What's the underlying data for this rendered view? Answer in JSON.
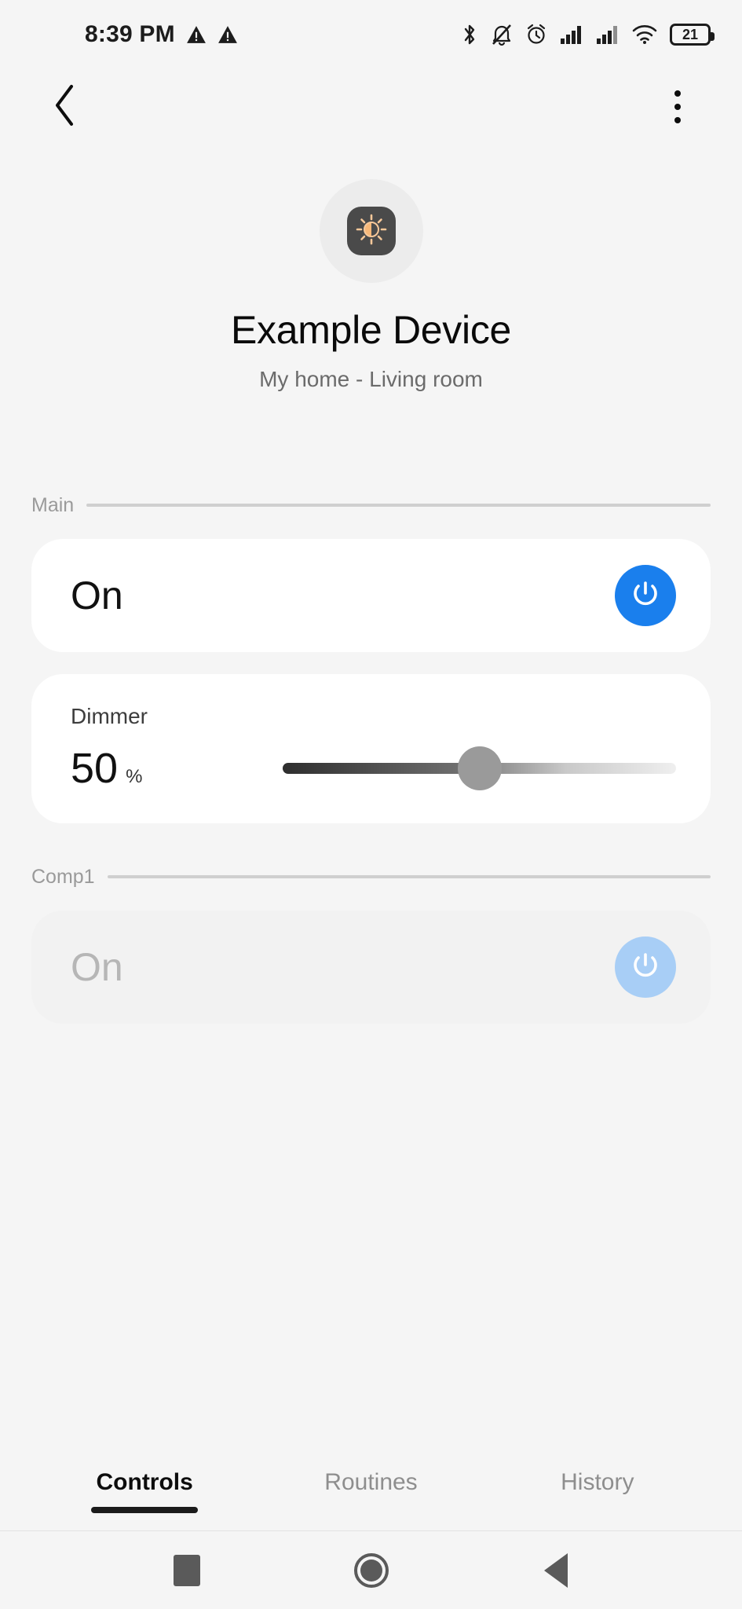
{
  "status_bar": {
    "time": "8:39 PM",
    "left_icons": [
      "warning-triangle-icon",
      "warning-triangle-icon"
    ],
    "right_icons": [
      "bluetooth-icon",
      "notifications-muted-icon",
      "alarm-clock-icon",
      "signal-bars-icon",
      "signal-bars-icon",
      "wifi-icon"
    ],
    "battery_level": "21"
  },
  "app_bar": {
    "back_label": "Back",
    "overflow_label": "More options"
  },
  "device": {
    "icon": "dimmer-brightness-icon",
    "icon_color": "#f5b173",
    "icon_tile_color": "#4a4a4a",
    "name": "Example Device",
    "location": "My home - Living room"
  },
  "sections": [
    {
      "label": "Main",
      "cards": [
        {
          "type": "onoff",
          "state_text": "On",
          "enabled": true,
          "power_button_color": "#1a7fed"
        },
        {
          "type": "dimmer",
          "label": "Dimmer",
          "value": "50",
          "unit": "%",
          "slider_percent": 50,
          "slider_min": 0,
          "slider_max": 100
        }
      ]
    },
    {
      "label": "Comp1",
      "cards": [
        {
          "type": "onoff",
          "state_text": "On",
          "enabled": false,
          "power_button_color": "#a8cef6"
        }
      ]
    }
  ],
  "tabs": [
    {
      "label": "Controls",
      "active": true
    },
    {
      "label": "Routines",
      "active": false
    },
    {
      "label": "History",
      "active": false
    }
  ],
  "nav_bar": {
    "recents": "recents-square-icon",
    "home": "home-circle-icon",
    "back": "back-triangle-icon"
  },
  "colors": {
    "page_background": "#f5f5f5",
    "card_background": "#ffffff",
    "card_disabled_background": "#f2f2f2",
    "accent_blue": "#1a7fed",
    "muted_blue": "#a8cef6",
    "section_label": "#9a9a9a"
  }
}
